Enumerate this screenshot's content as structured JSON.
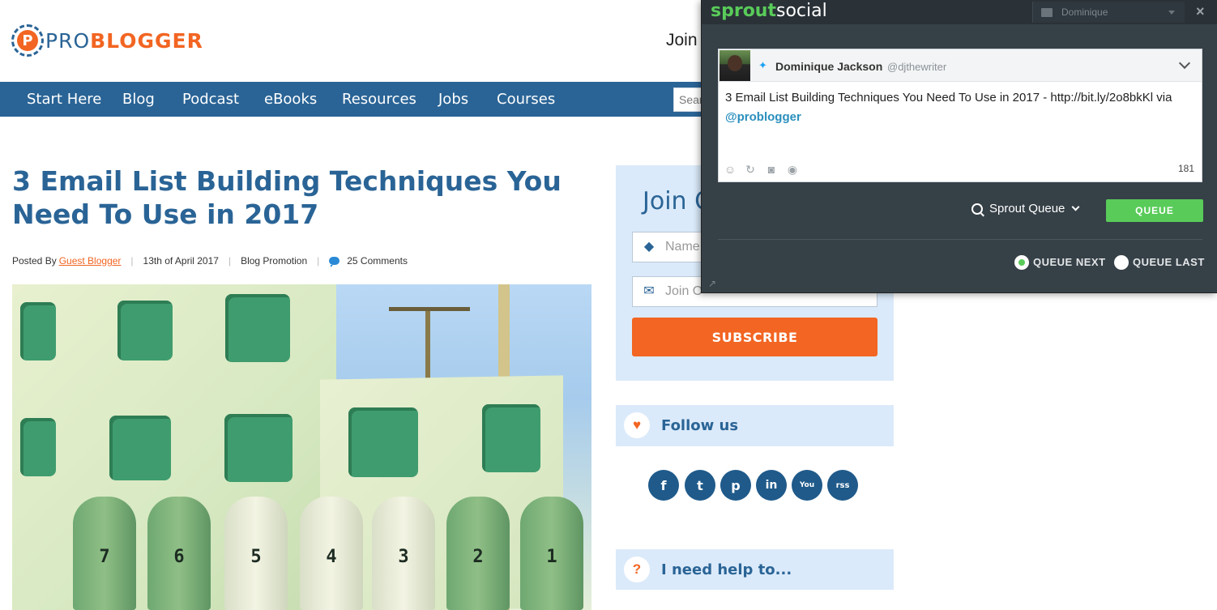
{
  "header": {
    "logo_mark": "P",
    "logo_pro": "PRO",
    "logo_blogger": "BLOGGER",
    "join_text": "Join"
  },
  "nav": {
    "items": [
      "Start Here",
      "Blog",
      "Podcast",
      "eBooks",
      "Resources",
      "Jobs",
      "Courses"
    ],
    "search_placeholder": "Sear"
  },
  "article": {
    "title": "3 Email List Building Techniques You Need To Use in 2017",
    "posted_by_label": "Posted By",
    "author": "Guest Blogger",
    "date": "13th of April 2017",
    "category": "Blog Promotion",
    "comments": "25 Comments",
    "mailbox_numbers": [
      "7",
      "6",
      "5",
      "4",
      "3",
      "2",
      "1"
    ]
  },
  "sidebar": {
    "join_title": "Join O",
    "name_placeholder": "Name",
    "email_placeholder": "Join O",
    "subscribe_label": "SUBSCRIBE",
    "follow_title": "Follow us",
    "social_icons": [
      "f",
      "t",
      "p",
      "in",
      "You",
      "rss"
    ],
    "help_title": "I need help to...",
    "help_icon": "?"
  },
  "sprout": {
    "brand_sprout": "sprout",
    "brand_social": "social",
    "profile": "Dominique",
    "close": "×",
    "account_name": "Dominique Jackson",
    "account_handle": "@djthewriter",
    "tweet_text": "3 Email List Building Techniques You Need To Use in 2017 - http://bit.ly/2o8bkKl via ",
    "tweet_mention": "@problogger",
    "char_count": "181",
    "queue_select": "Sprout Queue",
    "queue_button": "QUEUE",
    "queue_next": "QUEUE NEXT",
    "queue_last": "QUEUE LAST"
  },
  "colors": {
    "brand_blue": "#2a6496",
    "brand_orange": "#f26522",
    "sprout_green": "#59cb59",
    "sprout_bg": "#364047"
  }
}
